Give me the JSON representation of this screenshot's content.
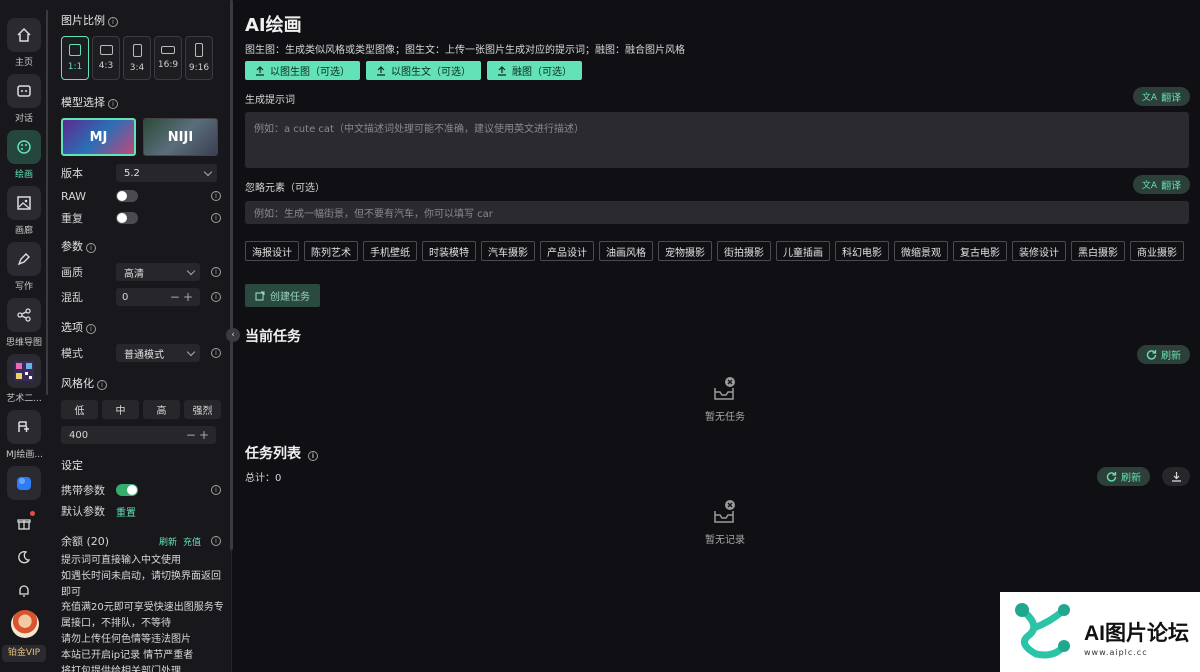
{
  "rail": {
    "items": [
      {
        "label": "主页",
        "icon": "home-icon"
      },
      {
        "label": "对话",
        "icon": "chat-icon"
      },
      {
        "label": "绘画",
        "icon": "palette-icon"
      },
      {
        "label": "画廊",
        "icon": "gallery-icon"
      },
      {
        "label": "写作",
        "icon": "pen-icon"
      },
      {
        "label": "思维导图",
        "icon": "mindmap-icon"
      },
      {
        "label": "艺术二...",
        "icon": "art-qr-icon"
      },
      {
        "label": "MJ绘画...",
        "icon": "mj-icon"
      }
    ],
    "vip": "铂金VIP"
  },
  "panel": {
    "ratio_title": "图片比例",
    "ratios": [
      "1:1",
      "4:3",
      "3:4",
      "16:9",
      "9:16"
    ],
    "model_title": "模型选择",
    "models": [
      "MJ",
      "NIJI"
    ],
    "version_label": "版本",
    "version_value": "5.2",
    "raw_label": "RAW",
    "repeat_label": "重复",
    "params_title": "参数",
    "quality_label": "画质",
    "quality_value": "高清",
    "chaos_label": "混乱",
    "chaos_value": "0",
    "options_title": "选项",
    "mode_label": "模式",
    "mode_value": "普通模式",
    "stylize_title": "风格化",
    "stylize_levels": [
      "低",
      "中",
      "高",
      "强烈"
    ],
    "stylize_value": "400",
    "settings_title": "设定",
    "carry_label": "携带参数",
    "default_label": "默认参数",
    "reset_label": "重置",
    "balance_label": "余额 (20)",
    "refresh_link": "刷新",
    "recharge_link": "充值",
    "tips": [
      "提示词可直接输入中文使用",
      "如遇长时间未启动，请切换界面返回即可",
      "充值满20元即可享受快速出图服务专属接口，不排队，不等待",
      "请勿上传任何色情等违法图片",
      "本站已开启ip记录 情节严重者",
      "将打包提供给相关部门处理"
    ]
  },
  "main": {
    "title": "AI绘画",
    "description": "图生图：生成类似风格或类型图像；图生文：上传一张图片生成对应的提示词；融图：融合图片风格",
    "upload_buttons": [
      "以图生图（可选）",
      "以图生文（可选）",
      "融图（可选）"
    ],
    "prompt_label": "生成提示词",
    "translate_label": "翻译",
    "prompt_placeholder": "例如：a cute cat（中文描述词处理可能不准确，建议使用英文进行描述）",
    "negative_label": "忽略元素（可选）",
    "negative_placeholder": "例如：生成一幅街景，但不要有汽车，你可以填写 car",
    "tags": [
      "海报设计",
      "陈列艺术",
      "手机壁纸",
      "时装模特",
      "汽车摄影",
      "产品设计",
      "油画风格",
      "宠物摄影",
      "街拍摄影",
      "儿童插画",
      "科幻电影",
      "微缩景观",
      "复古电影",
      "装修设计",
      "黑白摄影",
      "商业摄影"
    ],
    "create_label": "创建任务",
    "current_title": "当前任务",
    "refresh_label": "刷新",
    "no_task": "暂无任务",
    "list_title": "任务列表",
    "total_label": "总计：",
    "total_value": "0",
    "no_record": "暂无记录"
  },
  "watermark": {
    "text": "AI图片论坛",
    "url": "www.aiplc.cc"
  },
  "colors": {
    "accent": "#63e2b7",
    "background": "#101014",
    "panel": "#18181c"
  }
}
